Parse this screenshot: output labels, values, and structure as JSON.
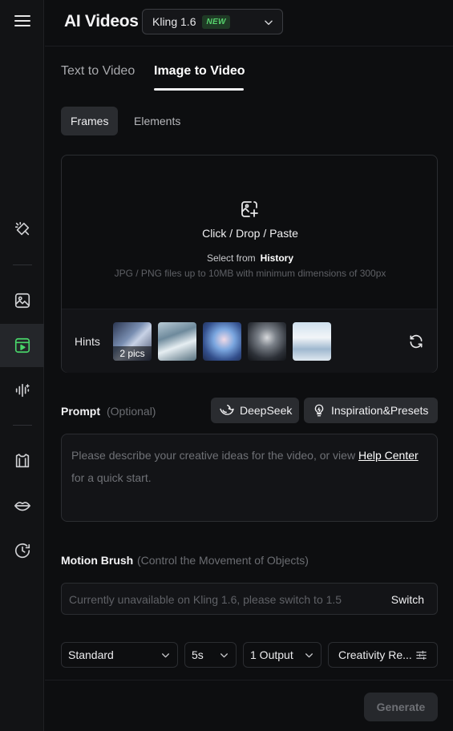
{
  "header": {
    "title": "AI Videos",
    "model": {
      "name": "Kling 1.6",
      "badge": "NEW"
    }
  },
  "tabs": [
    {
      "label": "Text to Video",
      "active": false
    },
    {
      "label": "Image to Video",
      "active": true
    }
  ],
  "subtabs": [
    {
      "label": "Frames",
      "active": true
    },
    {
      "label": "Elements",
      "active": false
    }
  ],
  "upload": {
    "cta": "Click / Drop / Paste",
    "select_from": "Select from",
    "history": "History",
    "requirements": "JPG / PNG files up to 10MB with minimum dimensions of 300px",
    "hints_label": "Hints",
    "first_thumb_count": "2 pics"
  },
  "prompt": {
    "label": "Prompt",
    "optional": "(Optional)",
    "deepseek": "DeepSeek",
    "inspiration": "Inspiration&Presets",
    "placeholder": "Please describe your creative ideas for the video, or view",
    "help_link": "Help Center",
    "placeholder_tail": "for a quick start."
  },
  "motion": {
    "label": "Motion Brush",
    "sub": "(Control the Movement of Objects)",
    "unavailable": "Currently unavailable on Kling 1.6, please switch to 1.5",
    "switch": "Switch"
  },
  "options": {
    "mode": "Standard",
    "duration": "5s",
    "outputs": "1 Output",
    "creativity": "Creativity Re..."
  },
  "generate": "Generate",
  "colors": {
    "accent_new": "#57d26d",
    "background": "#0d0e10"
  },
  "sidebar_icons": [
    "menu-icon",
    "magic-wand-icon",
    "image-icon",
    "video-icon",
    "audio-icon",
    "shirt-icon",
    "lips-icon",
    "history-icon"
  ]
}
